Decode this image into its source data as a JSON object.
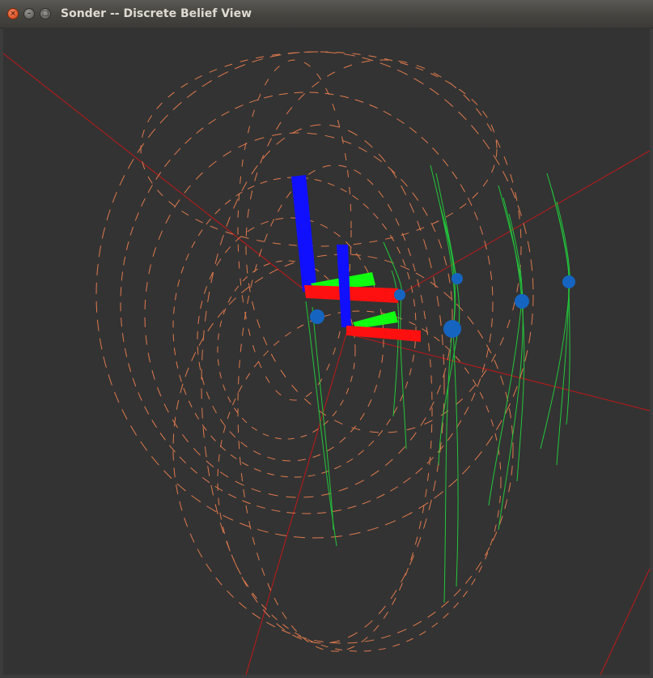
{
  "window": {
    "title": "Sonder -- Discrete Belief View",
    "close_glyph": "×",
    "minimize_glyph": "–",
    "maximize_glyph": "□"
  },
  "scene": {
    "background": "#333333",
    "colors": {
      "orbit": "#e07a4c",
      "trajectory": "#22c83a",
      "ray": "#c01818",
      "node": "#1565c0",
      "axis_x": "#ff1010",
      "axis_y": "#10ff10",
      "axis_z": "#1010ff"
    },
    "icons": [
      "close-icon",
      "minimize-icon",
      "maximize-icon"
    ]
  }
}
